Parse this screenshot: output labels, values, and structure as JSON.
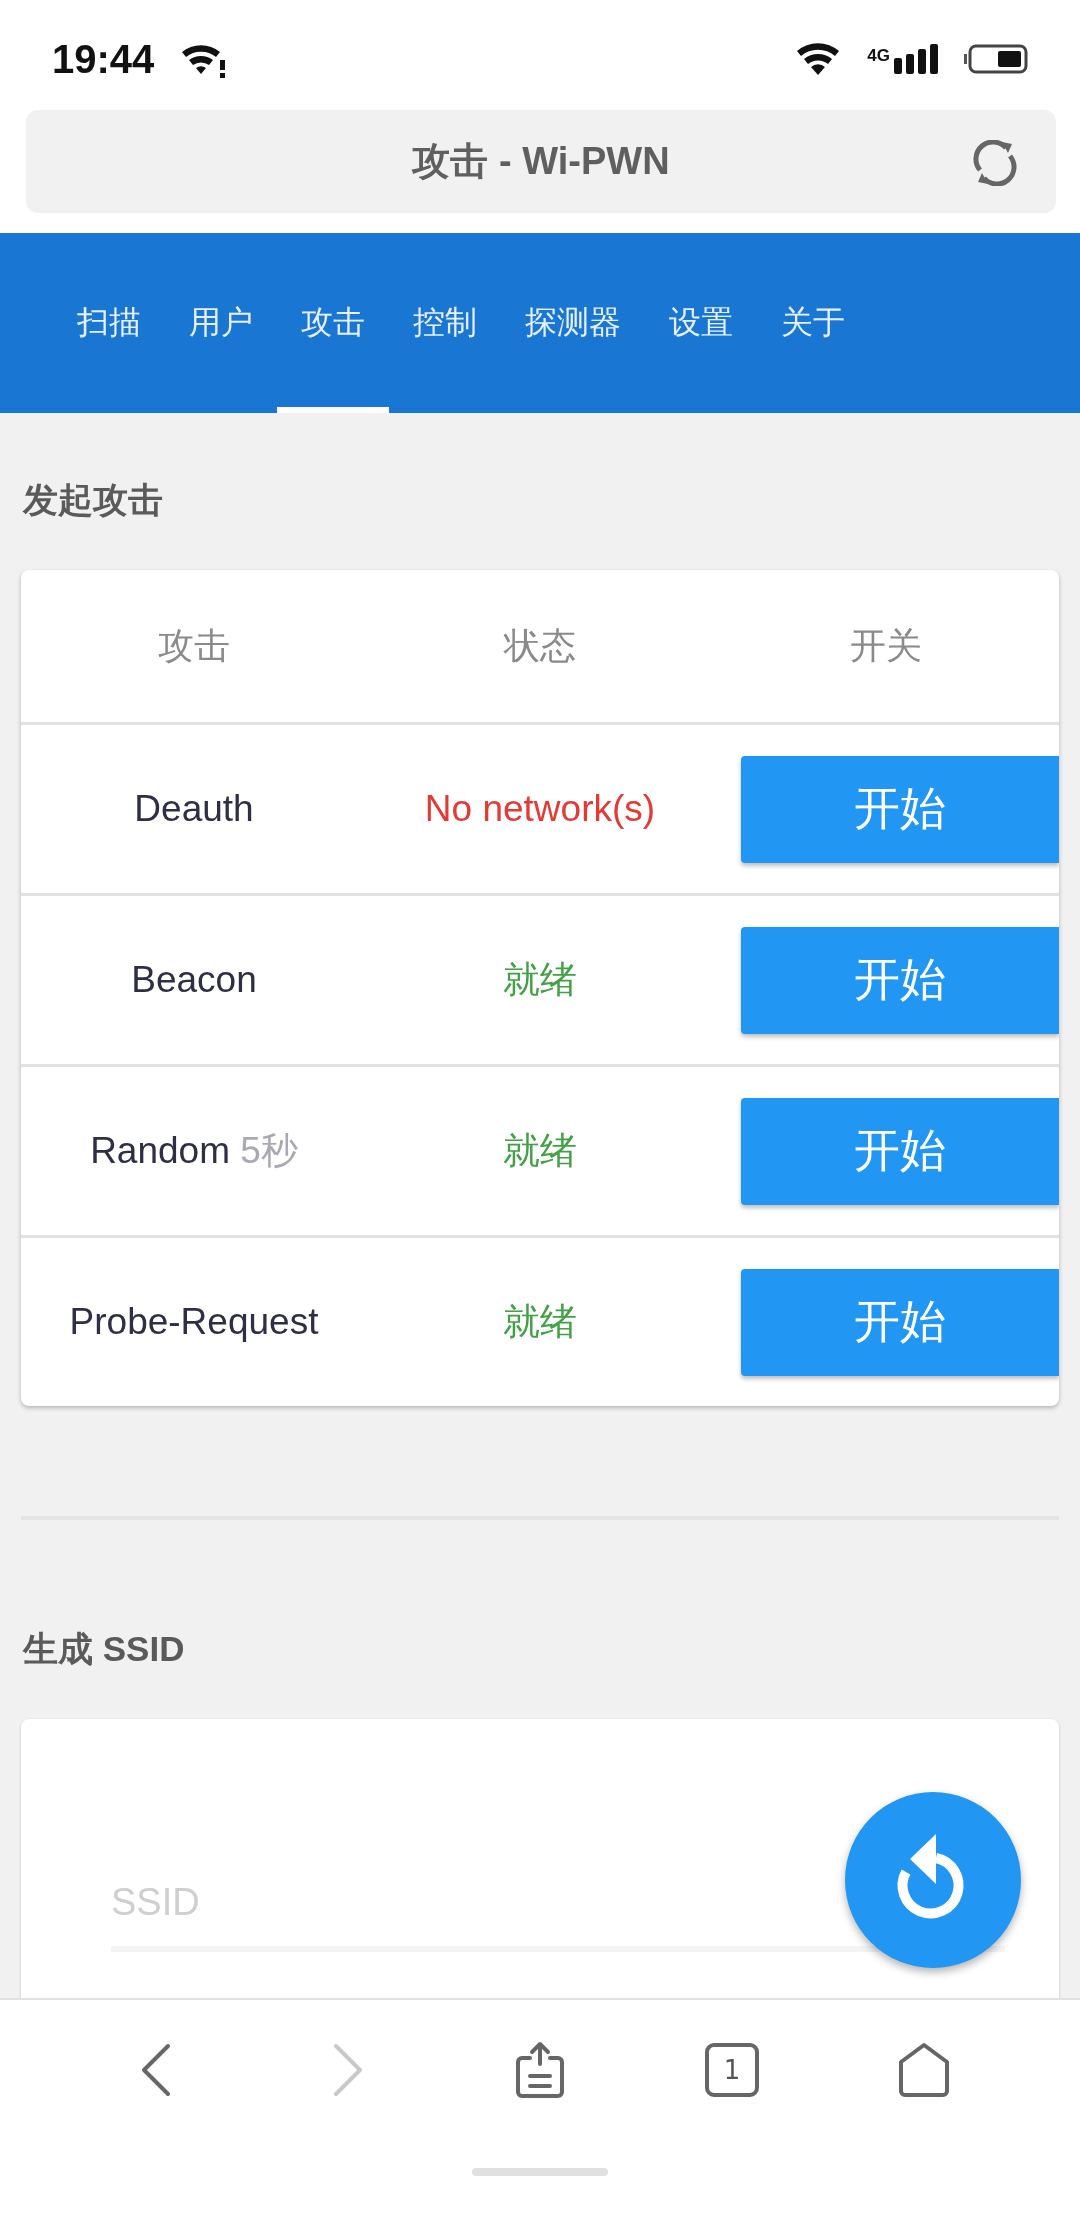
{
  "status_bar": {
    "time": "19:44",
    "network": "4G"
  },
  "address_bar": {
    "title": "攻击 - Wi-PWN"
  },
  "tabs": [
    {
      "label": "扫描",
      "selected": false
    },
    {
      "label": "用户",
      "selected": false
    },
    {
      "label": "攻击",
      "selected": true
    },
    {
      "label": "控制",
      "selected": false
    },
    {
      "label": "探测器",
      "selected": false
    },
    {
      "label": "设置",
      "selected": false
    },
    {
      "label": "关于",
      "selected": false
    }
  ],
  "attack_section": {
    "title": "发起攻击",
    "columns": [
      "攻击",
      "状态",
      "开关"
    ],
    "rows": [
      {
        "name": "Deauth",
        "status": "No network(s)",
        "color": "#e53935",
        "button": "开始"
      },
      {
        "name": "Beacon",
        "status": "就绪",
        "color": "#43a047",
        "button": "开始"
      },
      {
        "name": "Random",
        "note": "5秒",
        "status": "就绪",
        "color": "#43a047",
        "button": "开始"
      },
      {
        "name": "Probe-Request",
        "status": "就绪",
        "color": "#43a047",
        "button": "开始"
      }
    ]
  },
  "ssid_section": {
    "title": "生成 SSID",
    "field": {
      "placeholder": "SSID"
    }
  },
  "bottom_nav": [
    {
      "kind": "back",
      "disabled": false
    },
    {
      "kind": "forward",
      "disabled": true
    },
    {
      "kind": "share",
      "disabled": false
    },
    {
      "kind": "tabs",
      "label": "1",
      "disabled": false
    },
    {
      "kind": "home",
      "disabled": false
    }
  ]
}
